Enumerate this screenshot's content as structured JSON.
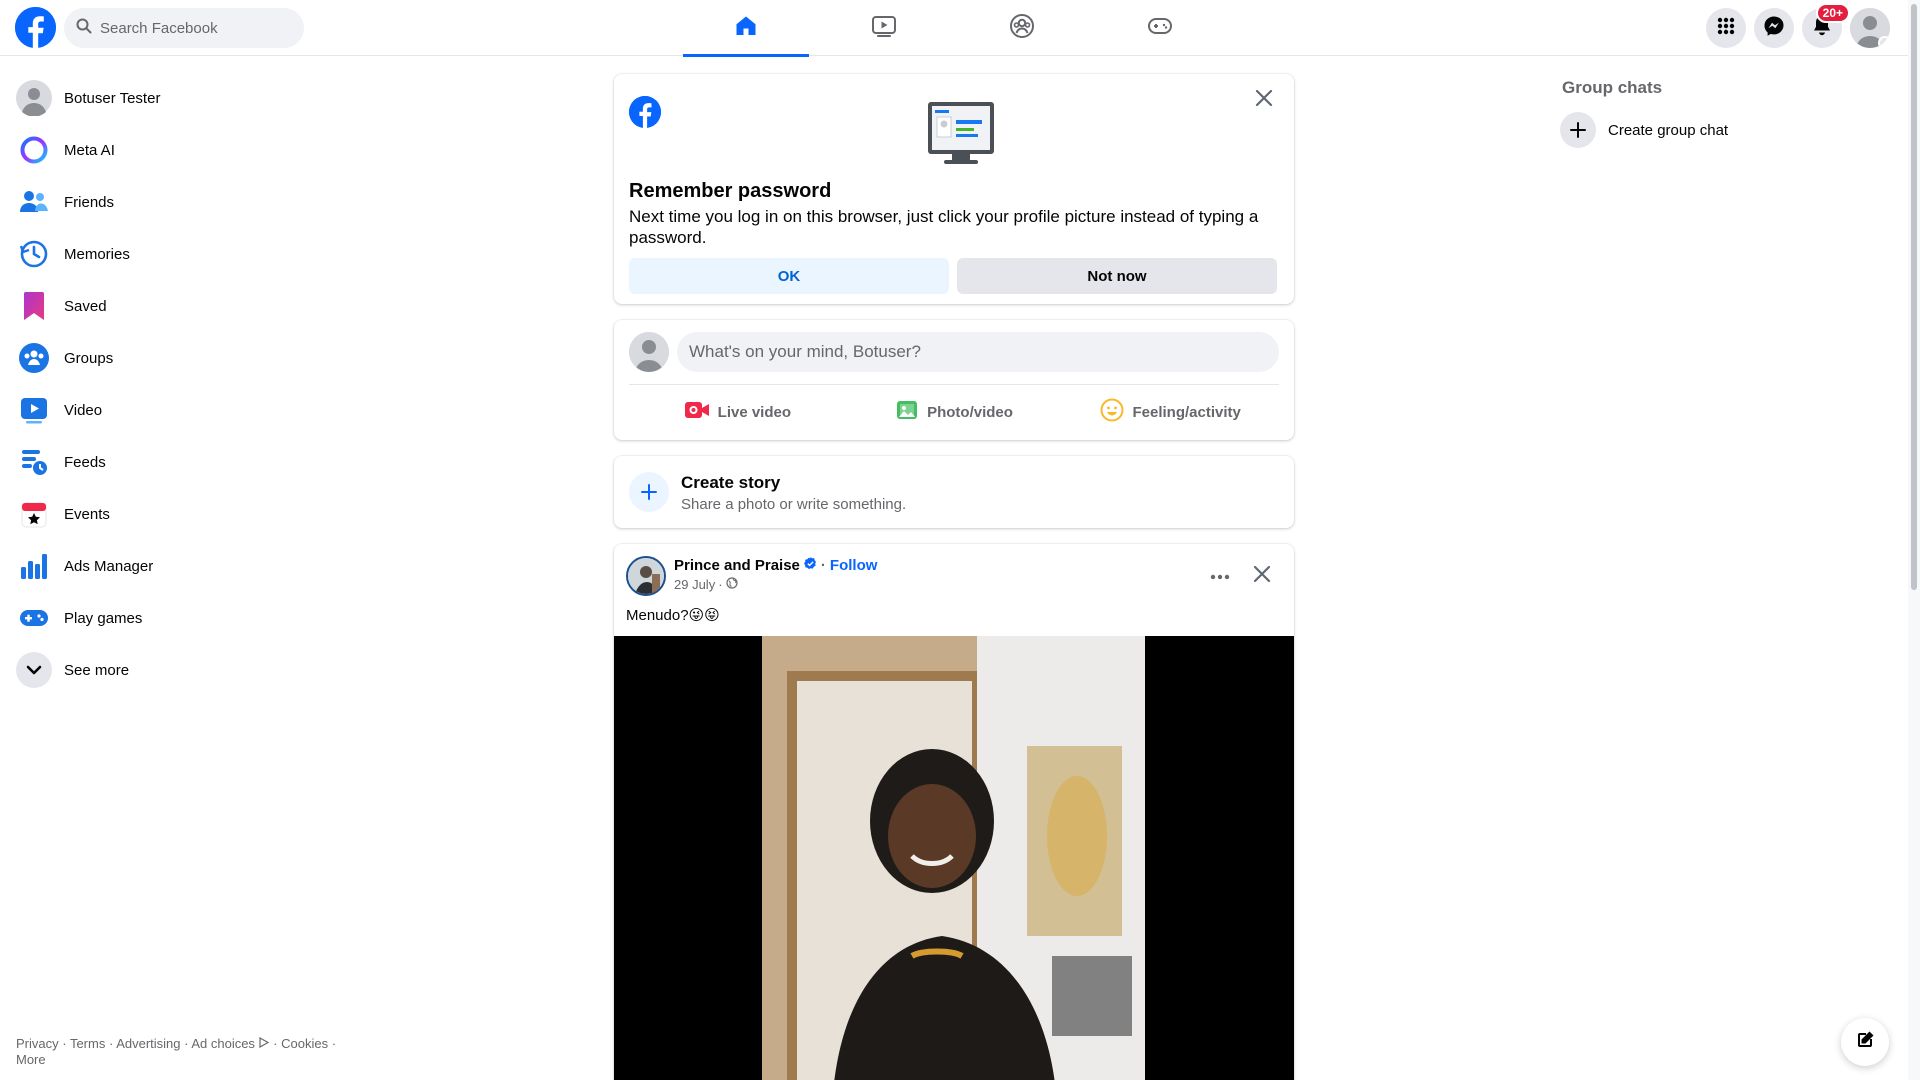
{
  "header": {
    "search_placeholder": "Search Facebook",
    "tabs": [
      {
        "icon": "home-icon",
        "active": true
      },
      {
        "icon": "video-icon",
        "active": false
      },
      {
        "icon": "groups-icon",
        "active": false
      },
      {
        "icon": "gaming-icon",
        "active": false
      }
    ],
    "notifications_badge": "20+",
    "colors": {
      "brand": "#0866ff",
      "badge": "#e41e3f"
    }
  },
  "sidebar": {
    "items": [
      {
        "label": "Botuser Tester",
        "icon": "profile-avatar-icon"
      },
      {
        "label": "Meta AI",
        "icon": "meta-ai-icon"
      },
      {
        "label": "Friends",
        "icon": "friends-icon"
      },
      {
        "label": "Memories",
        "icon": "memories-icon"
      },
      {
        "label": "Saved",
        "icon": "saved-icon"
      },
      {
        "label": "Groups",
        "icon": "groups-icon"
      },
      {
        "label": "Video",
        "icon": "video-icon"
      },
      {
        "label": "Feeds",
        "icon": "feeds-icon"
      },
      {
        "label": "Events",
        "icon": "events-icon"
      },
      {
        "label": "Ads Manager",
        "icon": "ads-manager-icon"
      },
      {
        "label": "Play games",
        "icon": "play-games-icon"
      },
      {
        "label": "See more",
        "icon": "chevron-down-icon"
      }
    ]
  },
  "footer": {
    "privacy": "Privacy",
    "terms": "Terms",
    "advertising": "Advertising",
    "ad_choices": "Ad choices",
    "cookies": "Cookies",
    "more": "More",
    "sep": " · "
  },
  "password_prompt": {
    "title": "Remember password",
    "description": "Next time you log in on this browser, just click your profile picture instead of typing a password.",
    "ok_label": "OK",
    "not_now_label": "Not now"
  },
  "composer": {
    "placeholder": "What's on your mind, Botuser?",
    "actions": [
      {
        "label": "Live video",
        "icon": "live-video-icon"
      },
      {
        "label": "Photo/video",
        "icon": "photo-video-icon"
      },
      {
        "label": "Feeling/activity",
        "icon": "feeling-icon"
      }
    ]
  },
  "story": {
    "title": "Create story",
    "subtitle": "Share a photo or write something."
  },
  "post": {
    "author": "Prince and Praise",
    "verified": true,
    "follow_label": "Follow",
    "dot": "·",
    "date": "29 July",
    "date_sep": "·",
    "text": "Menudo?😜😝"
  },
  "right": {
    "group_chats_title": "Group chats",
    "create_group_chat_label": "Create group chat"
  }
}
